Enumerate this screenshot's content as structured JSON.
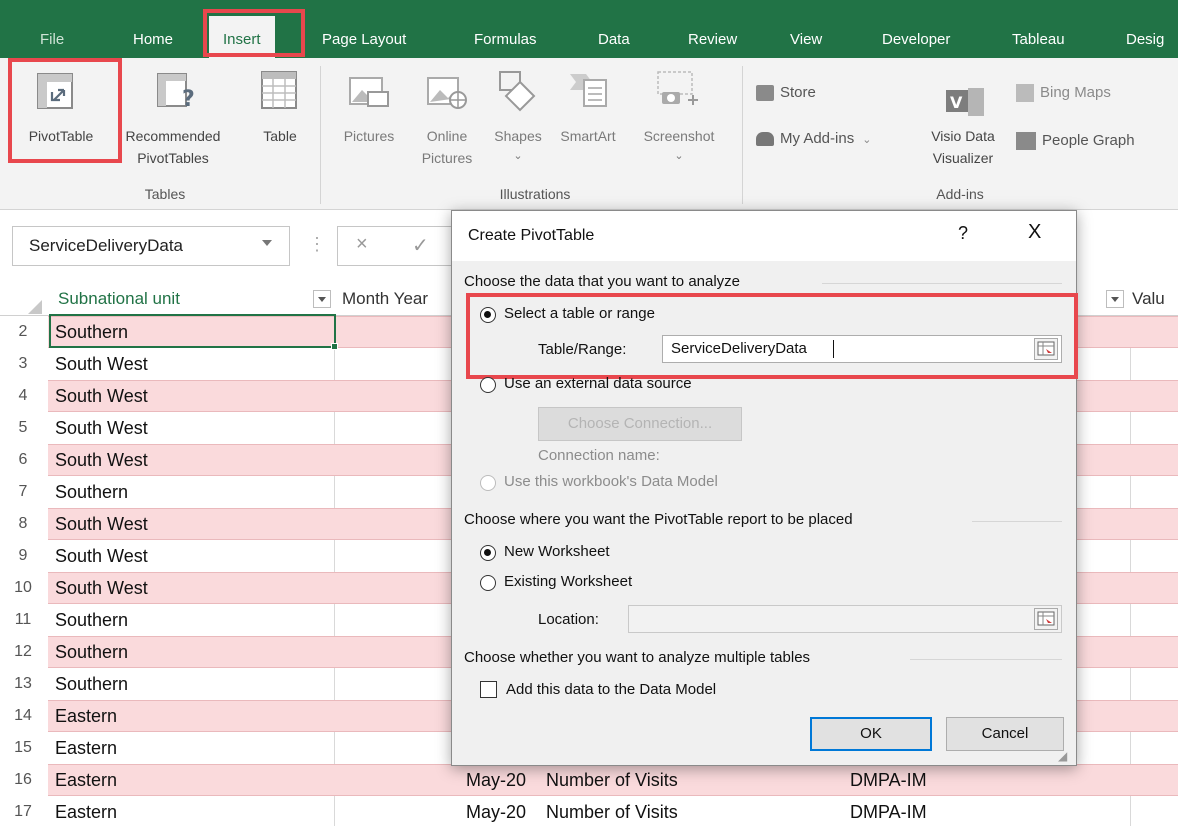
{
  "ribbon_tabs": [
    "File",
    "Home",
    "Insert",
    "Page Layout",
    "Formulas",
    "Data",
    "Review",
    "View",
    "Developer",
    "Tableau",
    "Desig"
  ],
  "ribbon": {
    "tables": {
      "pivot_table": "PivotTable",
      "recommended_line1": "Recommended",
      "recommended_line2": "PivotTables",
      "table": "Table",
      "group": "Tables"
    },
    "illustrations": {
      "pictures": "Pictures",
      "online_line1": "Online",
      "online_line2": "Pictures",
      "shapes": "Shapes",
      "smartart": "SmartArt",
      "screenshot": "Screenshot",
      "group": "Illustrations"
    },
    "addins": {
      "store": "Store",
      "my_addins": "My Add-ins",
      "visio_line1": "Visio Data",
      "visio_line2": "Visualizer",
      "bing_maps": "Bing Maps",
      "people_graph": "People Graph",
      "group": "Add-ins"
    }
  },
  "formula_bar": {
    "name_box": "ServiceDeliveryData",
    "cancel": "×",
    "enter": "✓"
  },
  "sheet": {
    "headers": {
      "col_a": "Subnational unit",
      "col_b": "Month Year",
      "col_e": "Valu"
    },
    "rows": [
      {
        "num": "2",
        "unit": "Southern"
      },
      {
        "num": "3",
        "unit": "South West"
      },
      {
        "num": "4",
        "unit": "South West"
      },
      {
        "num": "5",
        "unit": "South West"
      },
      {
        "num": "6",
        "unit": "South West"
      },
      {
        "num": "7",
        "unit": "Southern"
      },
      {
        "num": "8",
        "unit": "South West"
      },
      {
        "num": "9",
        "unit": "South West"
      },
      {
        "num": "10",
        "unit": "South West"
      },
      {
        "num": "11",
        "unit": "Southern"
      },
      {
        "num": "12",
        "unit": "Southern"
      },
      {
        "num": "13",
        "unit": "Southern"
      },
      {
        "num": "14",
        "unit": "Eastern"
      },
      {
        "num": "15",
        "unit": "Eastern"
      },
      {
        "num": "16",
        "unit": "Eastern",
        "month": "May-20",
        "indicator": "Number of Visits",
        "method": "DMPA-IM"
      },
      {
        "num": "17",
        "unit": "Eastern",
        "month": "May-20",
        "indicator": "Number of Visits",
        "method": "DMPA-IM"
      }
    ]
  },
  "dialog": {
    "title": "Create PivotTable",
    "help": "?",
    "close": "X",
    "section1": "Choose the data that you want to analyze",
    "opt_table": "Select a table or range",
    "table_range_label": "Table/Range:",
    "table_range_value": "ServiceDeliveryData",
    "opt_external": "Use an external data source",
    "choose_connection": "Choose Connection...",
    "connection_name": "Connection name:",
    "opt_data_model": "Use this workbook's Data Model",
    "section2": "Choose where you want the PivotTable report to be placed",
    "opt_new": "New Worksheet",
    "opt_existing": "Existing Worksheet",
    "location_label": "Location:",
    "section3": "Choose whether you want to analyze multiple tables",
    "add_data_model": "Add this data to the Data Model",
    "ok": "OK",
    "cancel": "Cancel"
  },
  "colors": {
    "excel_green": "#217346",
    "highlight_red": "#e8474d",
    "band_pink": "#fadadc",
    "focus_blue": "#0078d7"
  }
}
